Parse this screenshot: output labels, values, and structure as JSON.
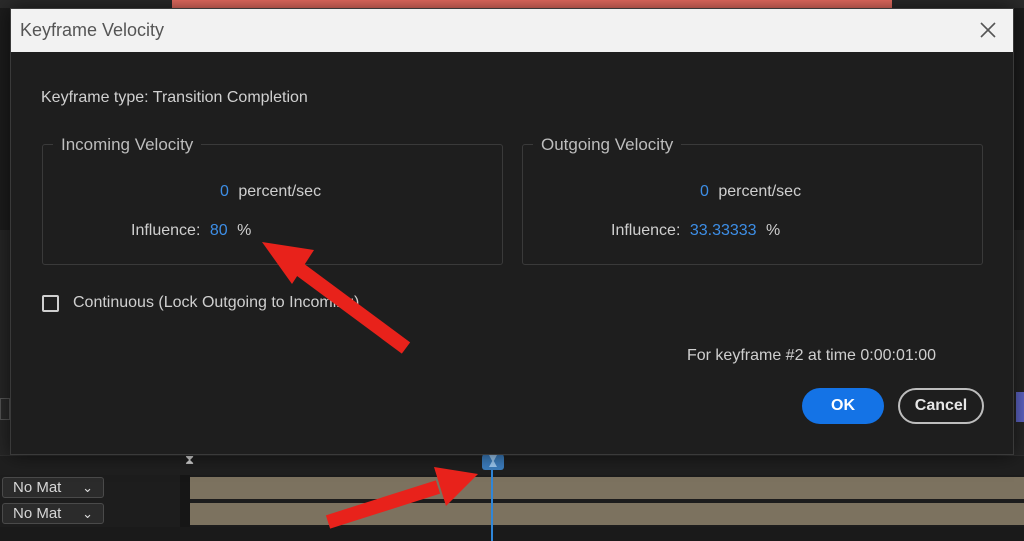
{
  "dialog": {
    "title": "Keyframe Velocity",
    "keyframe_type": "Keyframe type: Transition Completion",
    "incoming": {
      "legend": "Incoming Velocity",
      "velocity_value": "0",
      "velocity_unit": "percent/sec",
      "influence_label": "Influence:",
      "influence_value": "80",
      "influence_unit": "%"
    },
    "outgoing": {
      "legend": "Outgoing Velocity",
      "velocity_value": "0",
      "velocity_unit": "percent/sec",
      "influence_label": "Influence:",
      "influence_value": "33.33333",
      "influence_unit": "%"
    },
    "continuous_label": "Continuous (Lock Outgoing to Incoming)",
    "continuous_checked": false,
    "keyframe_info": "For keyframe #2 at time 0:00:01:00",
    "ok_label": "OK",
    "cancel_label": "Cancel"
  },
  "timeline": {
    "matte_rows": [
      {
        "label": "No Mat"
      },
      {
        "label": "No Mat"
      }
    ]
  },
  "colors": {
    "accent_bar": "#ec6f63",
    "value_blue": "#3d8ee6",
    "ok_button": "#1473e6",
    "annotation_arrow": "#e8221b",
    "playhead": "#2f86d8"
  },
  "icons": {
    "close": "close-icon",
    "dropdown": "chevron-down-icon",
    "keyframe": "keyframe-icon"
  }
}
